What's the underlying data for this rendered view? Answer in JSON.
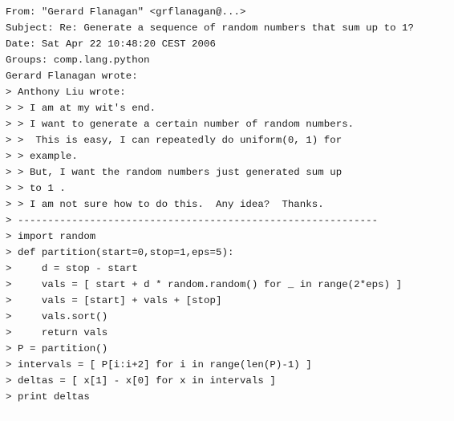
{
  "message": {
    "lines": [
      "From: \"Gerard Flanagan\" <grflanagan@...>",
      "Subject: Re: Generate a sequence of random numbers that sum up to 1?",
      "Date: Sat Apr 22 10:48:20 CEST 2006",
      "Groups: comp.lang.python",
      "Gerard Flanagan wrote:",
      "> Anthony Liu wrote:",
      "> > I am at my wit's end.",
      "> > I want to generate a certain number of random numbers.",
      "> >  This is easy, I can repeatedly do uniform(0, 1) for",
      "> > example.",
      "> > But, I want the random numbers just generated sum up",
      "> > to 1 .",
      "> > I am not sure how to do this.  Any idea?  Thanks.",
      "> ------------------------------------------------------------",
      "> import random",
      "> def partition(start=0,stop=1,eps=5):",
      ">     d = stop - start",
      ">     vals = [ start + d * random.random() for _ in range(2*eps) ]",
      ">     vals = [start] + vals + [stop]",
      ">     vals.sort()",
      ">     return vals",
      "> P = partition()",
      "> intervals = [ P[i:i+2] for i in range(len(P)-1) ]",
      "> deltas = [ x[1] - x[0] for x in intervals ]",
      "> print deltas"
    ]
  }
}
